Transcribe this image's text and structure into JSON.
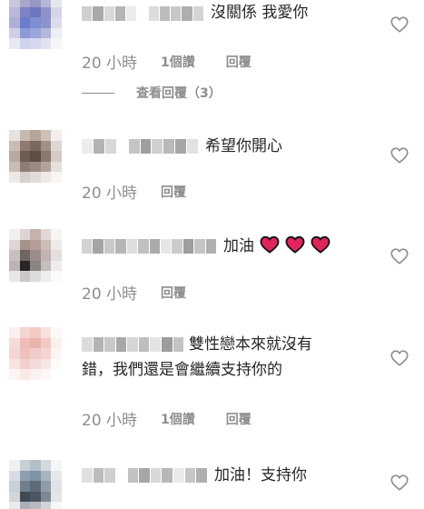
{
  "comments": [
    {
      "text": "沒關係 我愛你",
      "time": "20 小時",
      "likes": "1個讚",
      "reply": "回覆",
      "view_replies": "查看回覆（3）"
    },
    {
      "text": "希望你開心",
      "time": "20 小時",
      "reply": "回覆"
    },
    {
      "text": "加油",
      "time": "20 小時",
      "reply": "回覆"
    },
    {
      "text_line1": "雙性戀本來就沒有",
      "text_line2": "錯，我們還是會繼續支持你的",
      "time": "20 小時",
      "likes": "1個讚",
      "reply": "回覆"
    },
    {
      "text": "加油！支持你"
    }
  ],
  "icons": {
    "like": "heart-outline-icon",
    "emoji": "red-heart-emoji"
  },
  "colors": {
    "text": "#262626",
    "muted": "#8e8e8e",
    "heart_emoji": "#e0245e"
  }
}
